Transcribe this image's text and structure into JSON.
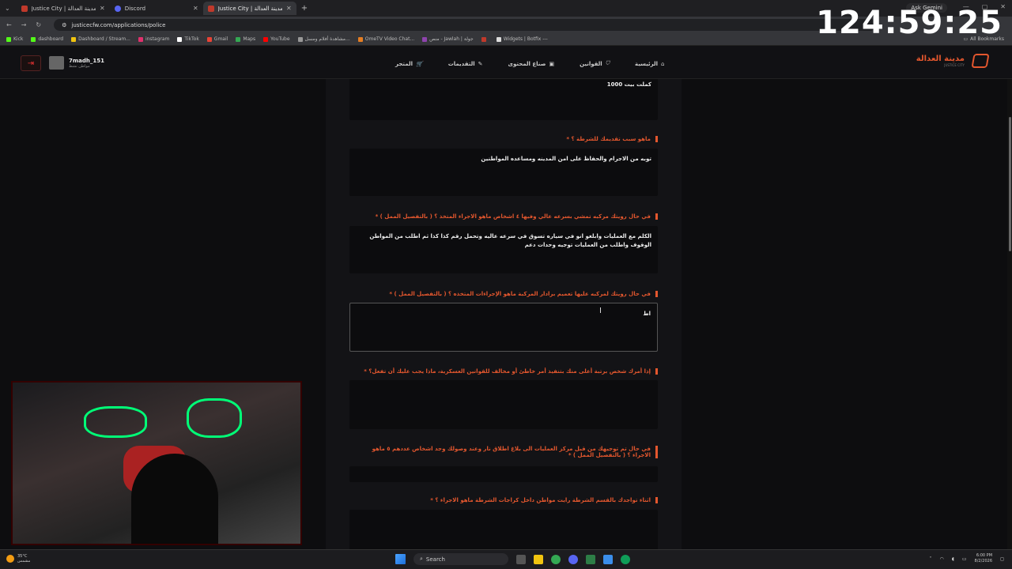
{
  "browser": {
    "tabs": [
      {
        "label": "Justice City | مدينة العدالة",
        "active": false
      },
      {
        "label": "Discord",
        "active": false
      },
      {
        "label": "Justice City | مدينة العدالة",
        "active": true
      }
    ],
    "url": "justicecfw.com/applications/police",
    "ask_gemini": "Ask Gemini",
    "bookmarks": [
      "Kick",
      "dashboard",
      "Dashboard / Stream...",
      "instagram",
      "TikTok",
      "Gmail",
      "Maps",
      "YouTube",
      "مشاهدة أفلام ومسل...",
      "OmeTV Video Chat...",
      "منص - Jawlah | جولة",
      "",
      "Widgets | Botfix ---"
    ],
    "all_bookmarks": "All Bookmarks"
  },
  "overlay_clock": "124:59:25",
  "site": {
    "user_name": "7madh_151",
    "user_role": "مواطن نشط",
    "nav": [
      "المتجر",
      "التقديمات",
      "صناع المحتوى",
      "القوانين",
      "الرئيسية"
    ],
    "brand_name": "مدينة العدالة",
    "brand_sub": "JUSTICE CITY"
  },
  "form": {
    "top_answer": "كملت بيت 1000",
    "questions": [
      {
        "q": "ماهو سبب تقديمك للشرطة ؟ *",
        "a": "توبه من الاجرام والحفاظ على امن المدينه ومساعده المواطنين"
      },
      {
        "q": "في حال رويتك مركبه تمشي بسرعه عالي وفيها ٤ اشخاص ماهو الاجراء المتخذ ؟ ( بالتفصيل الممل ) *",
        "a": "الكلم مع العمليات وابلغو انو في سياره تسوق في سرعه عاليه وتحمل رقم كذا كذا ثم اطلب من المواطن الوقوف واطلب من العمليات توجيه وحدات دعم"
      },
      {
        "q": "في حال رويتك لمركبه عليها تعميم برادار المركبة ماهو الإجراءات المتخذه ؟ ( بالتفصيل الممل ) *",
        "a": "اط"
      },
      {
        "q": "إذا أمرك شخص برتبة أعلى منك بتنفيذ أمر خاطئ أو مخالف للقوانين العسكرية، ماذا يجب عليك أن تفعل؟ *",
        "a": ""
      },
      {
        "q": "في حال تم توجيهك من قبل مركز العمليات الى بلاغ اطلاق نار وعند وصولك وجد اشخاص عددهم ٥ ماهو الاجراء ؟ ( بالتفصيل الممل ) *",
        "a": ""
      },
      {
        "q": "اثناء تواجدك بالقسم الشرطة رايت مواطن داخل كراجات الشرطة ماهو الاجراء ؟ *",
        "a": ""
      }
    ]
  },
  "taskbar": {
    "temp": "35°C",
    "weather": "مشمس",
    "search": "Search",
    "time": "6:00 PM",
    "date": "8/2/2026"
  }
}
